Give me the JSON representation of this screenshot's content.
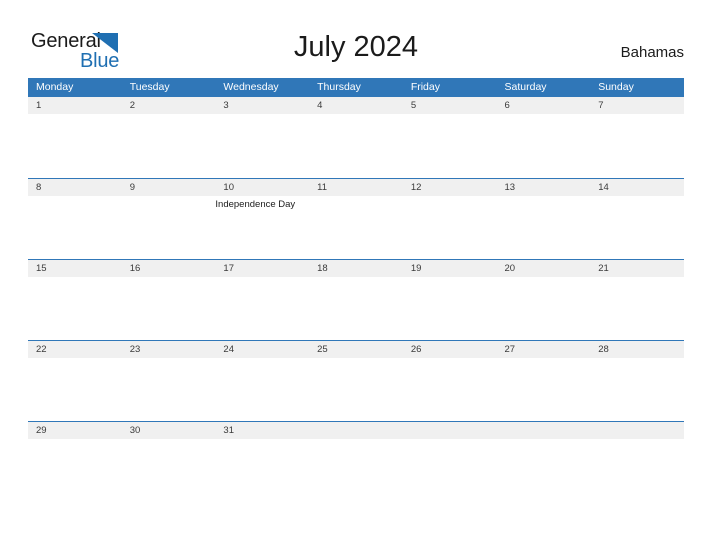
{
  "brand": {
    "name_part1": "General",
    "name_part2": "Blue",
    "triangle_icon": "triangle-flag-icon",
    "dark_color": "#1b1b1b",
    "blue_color": "#1f6fb2"
  },
  "header": {
    "title": "July 2024",
    "country": "Bahamas"
  },
  "theme": {
    "header_blue": "#3077b8",
    "date_strip_gray": "#f0f0f0",
    "row_border_blue": "#3077b8",
    "text_dark": "#1b1b1b",
    "page_background": "#ffffff"
  },
  "calendar": {
    "month": "July",
    "year": "2024",
    "week_start": "Monday",
    "weekdays": [
      "Monday",
      "Tuesday",
      "Wednesday",
      "Thursday",
      "Friday",
      "Saturday",
      "Sunday"
    ],
    "weeks": [
      {
        "days": [
          {
            "num": "1",
            "event": ""
          },
          {
            "num": "2",
            "event": ""
          },
          {
            "num": "3",
            "event": ""
          },
          {
            "num": "4",
            "event": ""
          },
          {
            "num": "5",
            "event": ""
          },
          {
            "num": "6",
            "event": ""
          },
          {
            "num": "7",
            "event": ""
          }
        ]
      },
      {
        "days": [
          {
            "num": "8",
            "event": ""
          },
          {
            "num": "9",
            "event": ""
          },
          {
            "num": "10",
            "event": "Independence Day"
          },
          {
            "num": "11",
            "event": ""
          },
          {
            "num": "12",
            "event": ""
          },
          {
            "num": "13",
            "event": ""
          },
          {
            "num": "14",
            "event": ""
          }
        ]
      },
      {
        "days": [
          {
            "num": "15",
            "event": ""
          },
          {
            "num": "16",
            "event": ""
          },
          {
            "num": "17",
            "event": ""
          },
          {
            "num": "18",
            "event": ""
          },
          {
            "num": "19",
            "event": ""
          },
          {
            "num": "20",
            "event": ""
          },
          {
            "num": "21",
            "event": ""
          }
        ]
      },
      {
        "days": [
          {
            "num": "22",
            "event": ""
          },
          {
            "num": "23",
            "event": ""
          },
          {
            "num": "24",
            "event": ""
          },
          {
            "num": "25",
            "event": ""
          },
          {
            "num": "26",
            "event": ""
          },
          {
            "num": "27",
            "event": ""
          },
          {
            "num": "28",
            "event": ""
          }
        ]
      },
      {
        "days": [
          {
            "num": "29",
            "event": ""
          },
          {
            "num": "30",
            "event": ""
          },
          {
            "num": "31",
            "event": ""
          },
          {
            "num": "",
            "event": ""
          },
          {
            "num": "",
            "event": ""
          },
          {
            "num": "",
            "event": ""
          },
          {
            "num": "",
            "event": ""
          }
        ]
      }
    ]
  }
}
